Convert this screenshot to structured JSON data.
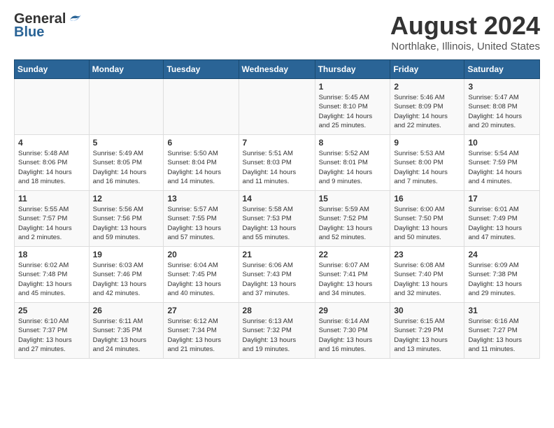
{
  "logo": {
    "general": "General",
    "blue": "Blue"
  },
  "title": "August 2024",
  "location": "Northlake, Illinois, United States",
  "headers": [
    "Sunday",
    "Monday",
    "Tuesday",
    "Wednesday",
    "Thursday",
    "Friday",
    "Saturday"
  ],
  "weeks": [
    [
      {
        "day": "",
        "info": ""
      },
      {
        "day": "",
        "info": ""
      },
      {
        "day": "",
        "info": ""
      },
      {
        "day": "",
        "info": ""
      },
      {
        "day": "1",
        "info": "Sunrise: 5:45 AM\nSunset: 8:10 PM\nDaylight: 14 hours\nand 25 minutes."
      },
      {
        "day": "2",
        "info": "Sunrise: 5:46 AM\nSunset: 8:09 PM\nDaylight: 14 hours\nand 22 minutes."
      },
      {
        "day": "3",
        "info": "Sunrise: 5:47 AM\nSunset: 8:08 PM\nDaylight: 14 hours\nand 20 minutes."
      }
    ],
    [
      {
        "day": "4",
        "info": "Sunrise: 5:48 AM\nSunset: 8:06 PM\nDaylight: 14 hours\nand 18 minutes."
      },
      {
        "day": "5",
        "info": "Sunrise: 5:49 AM\nSunset: 8:05 PM\nDaylight: 14 hours\nand 16 minutes."
      },
      {
        "day": "6",
        "info": "Sunrise: 5:50 AM\nSunset: 8:04 PM\nDaylight: 14 hours\nand 14 minutes."
      },
      {
        "day": "7",
        "info": "Sunrise: 5:51 AM\nSunset: 8:03 PM\nDaylight: 14 hours\nand 11 minutes."
      },
      {
        "day": "8",
        "info": "Sunrise: 5:52 AM\nSunset: 8:01 PM\nDaylight: 14 hours\nand 9 minutes."
      },
      {
        "day": "9",
        "info": "Sunrise: 5:53 AM\nSunset: 8:00 PM\nDaylight: 14 hours\nand 7 minutes."
      },
      {
        "day": "10",
        "info": "Sunrise: 5:54 AM\nSunset: 7:59 PM\nDaylight: 14 hours\nand 4 minutes."
      }
    ],
    [
      {
        "day": "11",
        "info": "Sunrise: 5:55 AM\nSunset: 7:57 PM\nDaylight: 14 hours\nand 2 minutes."
      },
      {
        "day": "12",
        "info": "Sunrise: 5:56 AM\nSunset: 7:56 PM\nDaylight: 13 hours\nand 59 minutes."
      },
      {
        "day": "13",
        "info": "Sunrise: 5:57 AM\nSunset: 7:55 PM\nDaylight: 13 hours\nand 57 minutes."
      },
      {
        "day": "14",
        "info": "Sunrise: 5:58 AM\nSunset: 7:53 PM\nDaylight: 13 hours\nand 55 minutes."
      },
      {
        "day": "15",
        "info": "Sunrise: 5:59 AM\nSunset: 7:52 PM\nDaylight: 13 hours\nand 52 minutes."
      },
      {
        "day": "16",
        "info": "Sunrise: 6:00 AM\nSunset: 7:50 PM\nDaylight: 13 hours\nand 50 minutes."
      },
      {
        "day": "17",
        "info": "Sunrise: 6:01 AM\nSunset: 7:49 PM\nDaylight: 13 hours\nand 47 minutes."
      }
    ],
    [
      {
        "day": "18",
        "info": "Sunrise: 6:02 AM\nSunset: 7:48 PM\nDaylight: 13 hours\nand 45 minutes."
      },
      {
        "day": "19",
        "info": "Sunrise: 6:03 AM\nSunset: 7:46 PM\nDaylight: 13 hours\nand 42 minutes."
      },
      {
        "day": "20",
        "info": "Sunrise: 6:04 AM\nSunset: 7:45 PM\nDaylight: 13 hours\nand 40 minutes."
      },
      {
        "day": "21",
        "info": "Sunrise: 6:06 AM\nSunset: 7:43 PM\nDaylight: 13 hours\nand 37 minutes."
      },
      {
        "day": "22",
        "info": "Sunrise: 6:07 AM\nSunset: 7:41 PM\nDaylight: 13 hours\nand 34 minutes."
      },
      {
        "day": "23",
        "info": "Sunrise: 6:08 AM\nSunset: 7:40 PM\nDaylight: 13 hours\nand 32 minutes."
      },
      {
        "day": "24",
        "info": "Sunrise: 6:09 AM\nSunset: 7:38 PM\nDaylight: 13 hours\nand 29 minutes."
      }
    ],
    [
      {
        "day": "25",
        "info": "Sunrise: 6:10 AM\nSunset: 7:37 PM\nDaylight: 13 hours\nand 27 minutes."
      },
      {
        "day": "26",
        "info": "Sunrise: 6:11 AM\nSunset: 7:35 PM\nDaylight: 13 hours\nand 24 minutes."
      },
      {
        "day": "27",
        "info": "Sunrise: 6:12 AM\nSunset: 7:34 PM\nDaylight: 13 hours\nand 21 minutes."
      },
      {
        "day": "28",
        "info": "Sunrise: 6:13 AM\nSunset: 7:32 PM\nDaylight: 13 hours\nand 19 minutes."
      },
      {
        "day": "29",
        "info": "Sunrise: 6:14 AM\nSunset: 7:30 PM\nDaylight: 13 hours\nand 16 minutes."
      },
      {
        "day": "30",
        "info": "Sunrise: 6:15 AM\nSunset: 7:29 PM\nDaylight: 13 hours\nand 13 minutes."
      },
      {
        "day": "31",
        "info": "Sunrise: 6:16 AM\nSunset: 7:27 PM\nDaylight: 13 hours\nand 11 minutes."
      }
    ]
  ]
}
